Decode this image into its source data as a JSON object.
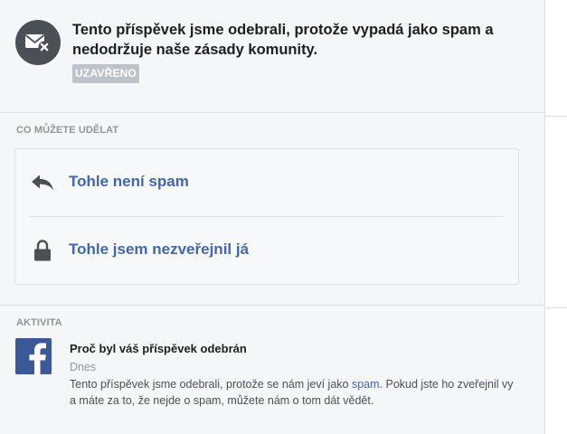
{
  "notice": {
    "icon": "mail-blocked-icon",
    "text": "Tento příspěvek jsme odebrali, protože vypadá jako spam a nedodržuje naše zásady komunity.",
    "status": "UZAVŘENO"
  },
  "options_section": {
    "title": "CO MŮŽETE UDĚLAT",
    "items": [
      {
        "icon": "reply-arrow-icon",
        "label": "Tohle není spam"
      },
      {
        "icon": "lock-icon",
        "label": "Tohle jsem nezveřejnil já"
      }
    ]
  },
  "activity_section": {
    "title": "AKTIVITA",
    "item": {
      "icon": "facebook-logo-icon",
      "title": "Proč byl váš příspěvek odebrán",
      "time": "Dnes",
      "body_before": "Tento příspěvek jsme odebrali, protože se nám jeví jako ",
      "body_link": "spam",
      "body_after": ". Pokud jste ho zveřejnil vy a máte za to, že nejde o spam, můžete nám o tom dát vědět."
    }
  },
  "colors": {
    "panel_bg": "#f5f6f7",
    "link": "#4267b2",
    "facebook_blue": "#3b5998",
    "badge_gray": "#bec3c9",
    "icon_dark": "#4b4f56"
  }
}
